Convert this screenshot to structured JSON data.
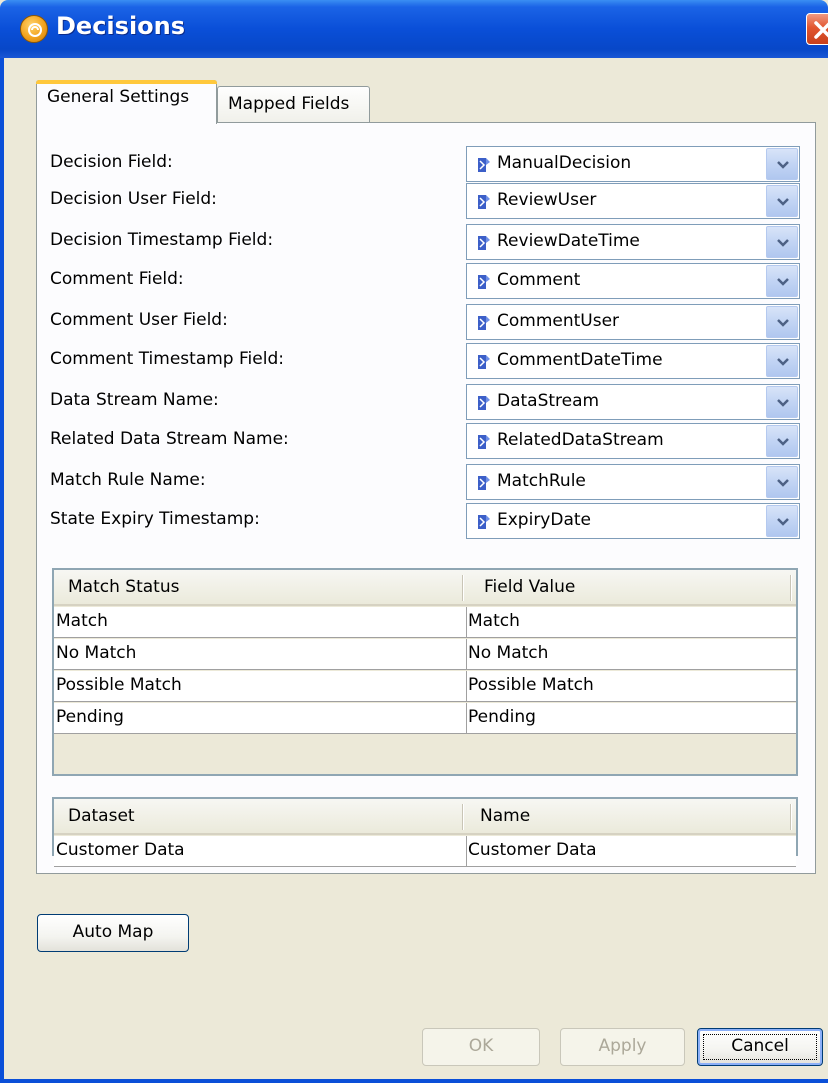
{
  "window": {
    "title": "Decisions"
  },
  "tabs": [
    {
      "label": "General Settings",
      "active": true
    },
    {
      "label": "Mapped Fields",
      "active": false
    }
  ],
  "fields": [
    {
      "label": "Decision Field:",
      "value": "ManualDecision"
    },
    {
      "label": "Decision User Field:",
      "value": "ReviewUser"
    },
    {
      "label": "Decision Timestamp Field:",
      "value": "ReviewDateTime"
    },
    {
      "label": "Comment Field:",
      "value": "Comment"
    },
    {
      "label": "Comment User Field:",
      "value": "CommentUser"
    },
    {
      "label": "Comment Timestamp Field:",
      "value": "CommentDateTime"
    },
    {
      "label": "Data Stream Name:",
      "value": "DataStream"
    },
    {
      "label": "Related Data Stream Name:",
      "value": "RelatedDataStream"
    },
    {
      "label": "Match Rule Name:",
      "value": "MatchRule"
    },
    {
      "label": "State Expiry Timestamp:",
      "value": "ExpiryDate"
    }
  ],
  "match_table": {
    "columns": [
      "Match Status",
      "Field Value"
    ],
    "rows": [
      [
        "Match",
        "Match"
      ],
      [
        "No Match",
        "No Match"
      ],
      [
        "Possible Match",
        "Possible Match"
      ],
      [
        "Pending",
        "Pending"
      ]
    ]
  },
  "dataset_table": {
    "columns": [
      "Dataset",
      "Name"
    ],
    "rows": [
      [
        "Customer Data",
        "Customer Data"
      ]
    ]
  },
  "buttons": {
    "auto_map": "Auto Map",
    "ok": "OK",
    "apply": "Apply",
    "cancel": "Cancel"
  },
  "icons": {
    "title": "app-logo-icon",
    "close": "close-icon",
    "field": "field-icon",
    "dropdown": "chevron-down-icon"
  },
  "colors": {
    "title_bar": "#0A4FD8",
    "close_button": "#E2562F",
    "tab_highlight": "#FFC83C",
    "dialog_bg": "#ECE9D8"
  }
}
